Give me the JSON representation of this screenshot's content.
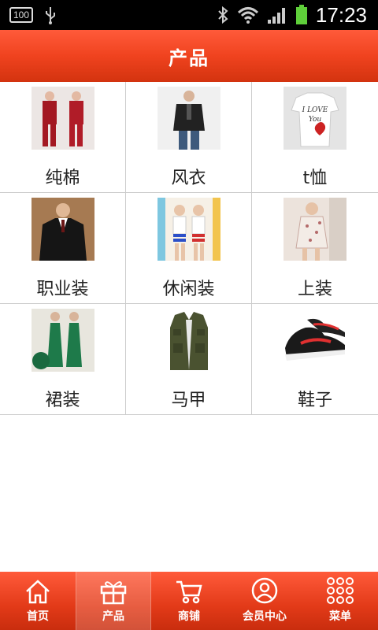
{
  "status": {
    "time": "17:23",
    "battery_level": "100"
  },
  "header": {
    "title": "产品"
  },
  "products": [
    {
      "label": "纯棉"
    },
    {
      "label": "风衣"
    },
    {
      "label": "t恤"
    },
    {
      "label": "职业装"
    },
    {
      "label": "休闲装"
    },
    {
      "label": "上装"
    },
    {
      "label": "裙装"
    },
    {
      "label": "马甲"
    },
    {
      "label": "鞋子"
    }
  ],
  "tabs": [
    {
      "label": "首页",
      "icon": "home-icon"
    },
    {
      "label": "产品",
      "icon": "gift-icon",
      "active": true
    },
    {
      "label": "商铺",
      "icon": "cart-icon"
    },
    {
      "label": "会员中心",
      "icon": "user-icon"
    },
    {
      "label": "菜单",
      "icon": "menu-grid-icon"
    }
  ],
  "colors": {
    "accent": "#f0431f",
    "status_bar": "#000000",
    "battery": "#5fcf3a"
  }
}
